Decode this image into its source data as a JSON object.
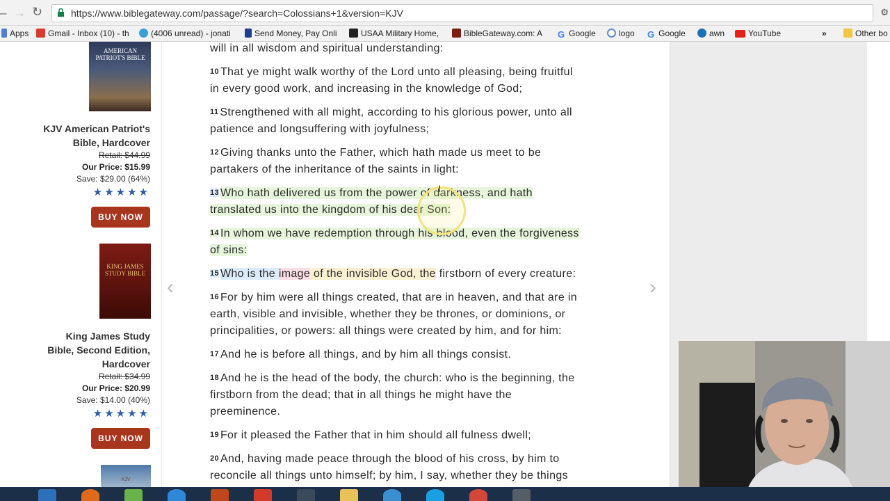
{
  "browser": {
    "url": "https://www.biblegateway.com/passage/?search=Colossians+1&version=KJV",
    "bookmarks": [
      {
        "label": "Apps",
        "icon": "apps-grid-icon",
        "color": "#4a7fd4"
      },
      {
        "label": "Gmail - Inbox (10) - th",
        "icon": "gmail-icon",
        "color": "#d23f31"
      },
      {
        "label": "(4006 unread) - jonati",
        "icon": "yahoo-mail-icon",
        "color": "#3a9fd8"
      },
      {
        "label": "Send Money, Pay Onli",
        "icon": "paypal-icon",
        "color": "#1d3f8c"
      },
      {
        "label": "USAA Military Home,",
        "icon": "usaa-icon",
        "color": "#222222"
      },
      {
        "label": "BibleGateway.com: A",
        "icon": "biblegateway-icon",
        "color": "#7a1f12"
      },
      {
        "label": "Google",
        "icon": "google-icon",
        "color": "#4285f4"
      },
      {
        "label": "logo",
        "icon": "globe-icon",
        "color": "#5b8bd8"
      },
      {
        "label": "Google",
        "icon": "google-icon",
        "color": "#4285f4"
      },
      {
        "label": "awn",
        "icon": "awn-icon",
        "color": "#1f6fb6"
      },
      {
        "label": "YouTube",
        "icon": "youtube-icon",
        "color": "#e62117"
      }
    ],
    "more_label": "»",
    "other_bookmarks": "Other bo"
  },
  "sidebar": {
    "products": [
      {
        "cover_text": "AMERICAN PATRIOT'S BIBLE",
        "title": [
          "KJV American Patriot's",
          "Bible, Hardcover"
        ],
        "retail": "Retail: $44.99",
        "price": "Our Price: $15.99",
        "save": "Save: $29.00 (64%)",
        "stars": "★★★★★",
        "button": "BUY NOW"
      },
      {
        "cover_text": "KING JAMES STUDY BIBLE",
        "title": [
          "King James Study",
          "Bible, Second Edition,",
          "Hardcover"
        ],
        "retail": "Retail: $34.99",
        "price": "Our Price: $20.99",
        "save": "Save: $14.00 (40%)",
        "stars": "★★★★★",
        "button": "BUY NOW"
      }
    ],
    "third_cover_text": "KJV"
  },
  "passage": {
    "line0": "will in all wisdom and spiritual understanding:",
    "verses": [
      {
        "num": "10",
        "lines": [
          "That ye might walk worthy of the Lord unto all pleasing, being fruitful",
          "in every good work, and increasing in the knowledge of God;"
        ]
      },
      {
        "num": "11",
        "lines": [
          "Strengthened with all might, according to his glorious power, unto all",
          "patience and longsuffering with joyfulness;"
        ]
      },
      {
        "num": "12",
        "lines": [
          "Giving thanks unto the Father, which hath made us meet to be",
          "partakers of the inheritance of the saints in light:"
        ]
      },
      {
        "num": "13",
        "lines": [
          "Who hath delivered us from the power of darkness, and hath",
          "translated us into the kingdom of his dear Son:"
        ]
      },
      {
        "num": "14",
        "lines": [
          "In whom we have redemption through his blood, even the forgiveness",
          "of sins:"
        ]
      },
      {
        "num": "15",
        "parts": [
          "Who is the ",
          "image",
          " of the invisible God, the",
          " firstborn of every creature:"
        ]
      },
      {
        "num": "16",
        "lines": [
          "For by him were all things created, that are in heaven, and that are in",
          "earth, visible and invisible, whether they be thrones, or dominions, or",
          "principalities, or powers: all things were created by him, and for him:"
        ]
      },
      {
        "num": "17",
        "lines": [
          "And he is before all things, and by him all things consist."
        ]
      },
      {
        "num": "18",
        "lines": [
          "And he is the head of the body, the church: who is the beginning, the",
          "firstborn from the dead; that in all things he might have the",
          "preeminence."
        ]
      },
      {
        "num": "19",
        "lines": [
          "For it pleased the Father that in him should all fulness dwell;"
        ]
      },
      {
        "num": "20",
        "lines": [
          "And, having made peace through the blood of his cross, by him to",
          "reconcile all things unto himself; by him, I say, whether they be things"
        ]
      }
    ]
  },
  "nav": {
    "prev": "‹",
    "next": "›"
  },
  "colors": {
    "highlight_green": "#e6f5db",
    "highlight_blue": "#dcebfb",
    "highlight_pink": "#fbdde5",
    "highlight_yellow": "#fbf0cf",
    "buy_button": "#a8361f",
    "stars": "#2d5da1"
  }
}
